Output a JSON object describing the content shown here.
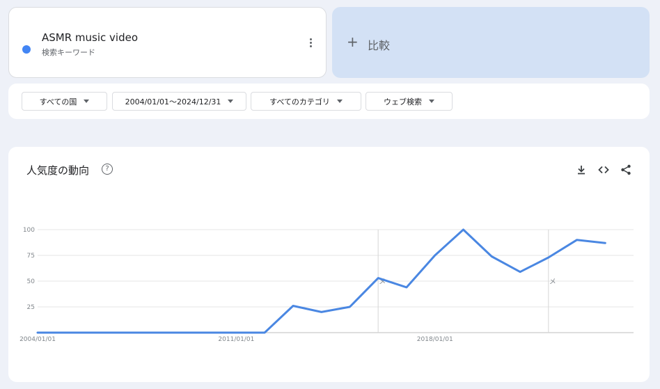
{
  "term": {
    "name": "ASMR music video",
    "subtitle": "検索キーワード",
    "color": "#4285f4"
  },
  "compare": {
    "plus": "+",
    "label": "比較"
  },
  "filters": [
    {
      "label": "すべての国"
    },
    {
      "label": "2004/01/01～2024/12/31"
    },
    {
      "label": "すべてのカテゴリ"
    },
    {
      "label": "ウェブ検索"
    }
  ],
  "chart_header": {
    "title": "人気度の動向",
    "help": "?"
  },
  "icons": {
    "help": "help-circle-icon",
    "download": "download-icon",
    "embed": "embed-code-icon",
    "share": "share-icon"
  },
  "chart_data": {
    "type": "line",
    "title": "人気度の動向",
    "ylim": [
      0,
      100
    ],
    "yticks": [
      25,
      50,
      75,
      100
    ],
    "grid": true,
    "x_labels": [
      "2004/01/01",
      "2011/01/01",
      "2018/01/01"
    ],
    "x_label_dates": [
      "2004-01-01",
      "2011-01-01",
      "2018-01-01"
    ],
    "x_start": "2004-01-01",
    "x_end": "2024-12-31",
    "series": [
      {
        "name": "ASMR music video",
        "color": "#4a87e2",
        "points": [
          [
            "2004-01-01",
            0
          ],
          [
            "2005-01-01",
            0
          ],
          [
            "2006-01-01",
            0
          ],
          [
            "2007-01-01",
            0
          ],
          [
            "2008-01-01",
            0
          ],
          [
            "2009-01-01",
            0
          ],
          [
            "2010-01-01",
            0
          ],
          [
            "2011-01-01",
            0
          ],
          [
            "2012-01-01",
            0
          ],
          [
            "2013-01-01",
            26
          ],
          [
            "2014-01-01",
            20
          ],
          [
            "2015-01-01",
            25
          ],
          [
            "2016-01-01",
            53
          ],
          [
            "2017-01-01",
            44
          ],
          [
            "2018-01-01",
            75
          ],
          [
            "2019-01-01",
            100
          ],
          [
            "2020-01-01",
            74
          ],
          [
            "2021-01-01",
            59
          ],
          [
            "2022-01-01",
            73
          ],
          [
            "2023-01-01",
            90
          ],
          [
            "2024-01-01",
            87
          ]
        ]
      }
    ],
    "annotations": [
      {
        "date": "2016-01-01",
        "label": "メ"
      },
      {
        "date": "2022-01-01",
        "label": "メ"
      }
    ]
  }
}
